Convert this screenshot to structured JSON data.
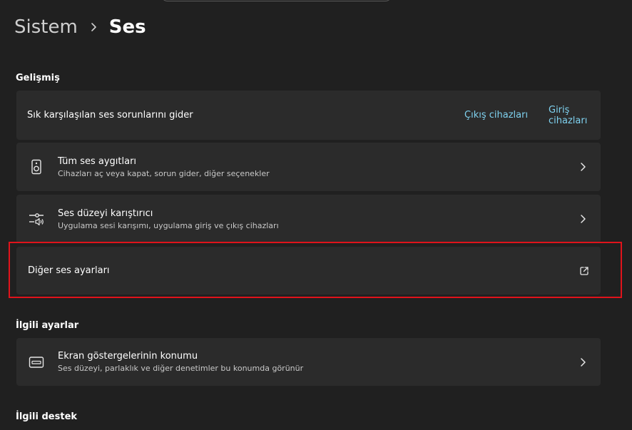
{
  "breadcrumb": {
    "parent": "Sistem",
    "current": "Ses"
  },
  "sections": {
    "advanced": "Gelişmiş",
    "related_settings": "İlgili ayarlar",
    "related_support": "İlgili destek"
  },
  "troubleshoot": {
    "label": "Sık karşılaşılan ses sorunlarını gider",
    "output_link": "Çıkış cihazları",
    "input_link": "Giriş cihazları"
  },
  "all_devices": {
    "title": "Tüm ses aygıtları",
    "subtitle": "Cihazları aç veya kapat, sorun gider, diğer seçenekler",
    "icon": "speaker-icon"
  },
  "volume_mixer": {
    "title": "Ses düzeyi karıştırıcı",
    "subtitle": "Uygulama sesi karışımı, uygulama giriş ve çıkış cihazları",
    "icon": "mixer-icon"
  },
  "more_sound": {
    "title": "Diğer ses ayarları",
    "icon": "external-link-icon"
  },
  "osd_position": {
    "title": "Ekran göstergelerinin konumu",
    "subtitle": "Ses düzeyi, parlaklık ve diğer denetimler bu konumda görünür",
    "icon": "display-overlay-icon"
  },
  "colors": {
    "background": "#202020",
    "card": "#2b2b2b",
    "link": "#7fd2f0",
    "highlight": "#e0131b"
  }
}
